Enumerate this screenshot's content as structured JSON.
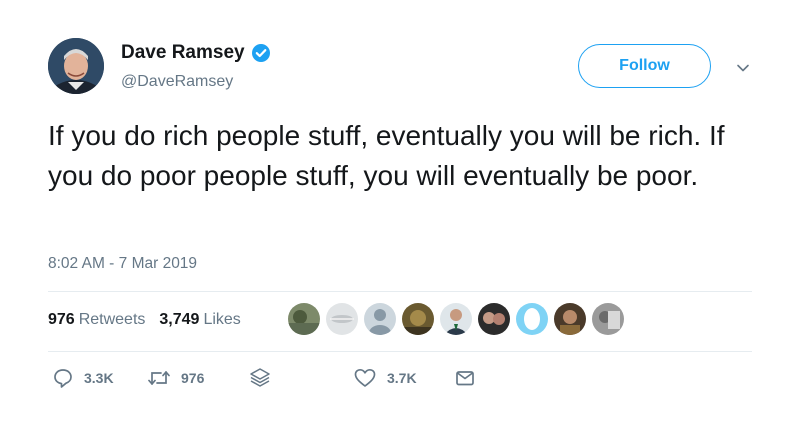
{
  "user": {
    "display_name": "Dave Ramsey",
    "handle": "@DaveRamsey",
    "verified": true,
    "avatar_icon": "profile-photo"
  },
  "follow_label": "Follow",
  "tweet": {
    "text": "If you do rich people stuff, eventually you will be rich. If you do poor people stuff, you will eventually be poor."
  },
  "timestamp": "8:02 AM - 7 Mar 2019",
  "stats": {
    "retweets_count": "976",
    "retweets_label": "Retweets",
    "likes_count": "3,749",
    "likes_label": "Likes"
  },
  "actions": {
    "reply_count": "3.3K",
    "retweet_count": "976",
    "like_count": "3.7K"
  },
  "colors": {
    "accent": "#1da1f2",
    "text": "#14171a",
    "muted": "#657786",
    "divider": "#e6ecf0"
  }
}
